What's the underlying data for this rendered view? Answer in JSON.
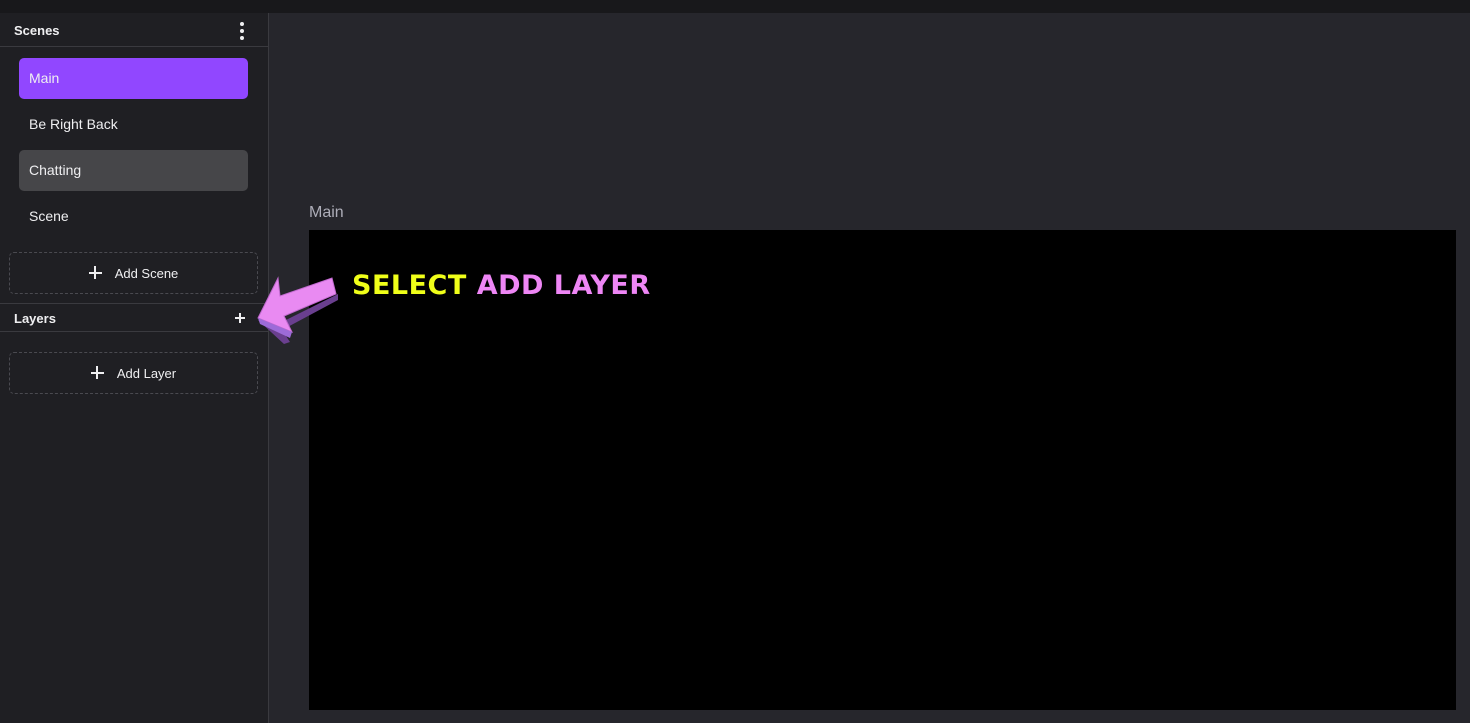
{
  "scenes_panel": {
    "title": "Scenes",
    "menu_icon": "kebab-menu-icon",
    "items": [
      {
        "label": "Main",
        "state": "active"
      },
      {
        "label": "Be Right Back",
        "state": "normal"
      },
      {
        "label": "Chatting",
        "state": "hover"
      },
      {
        "label": "Scene",
        "state": "normal"
      }
    ],
    "add_label": "Add Scene"
  },
  "layers_panel": {
    "title": "Layers",
    "add_icon": "plus-icon",
    "add_label": "Add Layer"
  },
  "preview": {
    "scene_name": "Main"
  },
  "annotation": {
    "part1": "SELECT",
    "part2": "ADD LAYER",
    "arrow_icon": "arrow-left-icon"
  },
  "colors": {
    "accent": "#9147ff",
    "annotation_yellow": "#f0ff19",
    "annotation_pink": "#ee86f5"
  }
}
